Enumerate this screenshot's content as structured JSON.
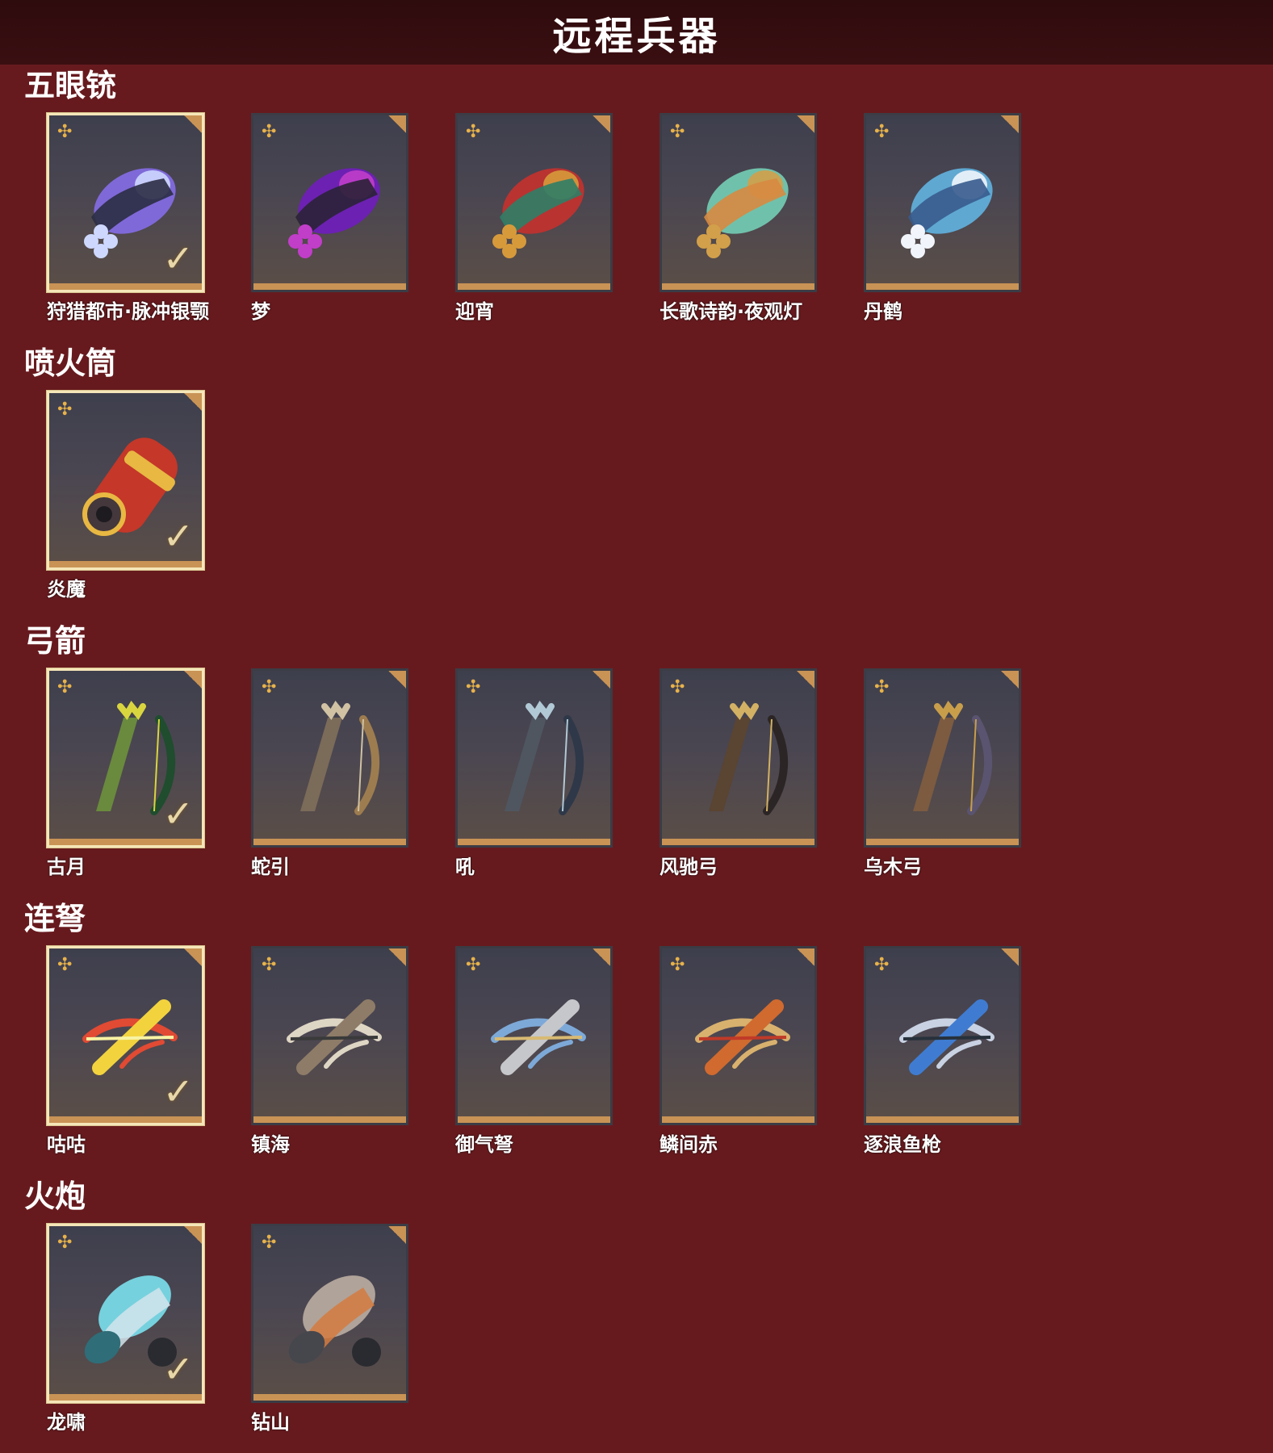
{
  "header": {
    "title": "远程兵器"
  },
  "sections": [
    {
      "title": "五眼铳",
      "items": [
        {
          "label": "狩猎都市·脉冲银颚",
          "equipped": true,
          "icon": "gun-icon",
          "colors": [
            "#7f69d8",
            "#ced8ff",
            "#2b2d44"
          ]
        },
        {
          "label": "梦",
          "equipped": false,
          "icon": "gun-icon",
          "colors": [
            "#6c21b2",
            "#c13ec9",
            "#2b2236"
          ]
        },
        {
          "label": "迎宵",
          "equipped": false,
          "icon": "gun-icon",
          "colors": [
            "#b93331",
            "#d79a3b",
            "#2f7e67"
          ]
        },
        {
          "label": "长歌诗韵·夜观灯",
          "equipped": false,
          "icon": "gun-icon",
          "colors": [
            "#70c1ab",
            "#d2a04a",
            "#d78a40"
          ]
        },
        {
          "label": "丹鹤",
          "equipped": false,
          "icon": "gun-icon",
          "colors": [
            "#5fa8d2",
            "#f1f5fb",
            "#385b8d"
          ]
        }
      ]
    },
    {
      "title": "喷火筒",
      "items": [
        {
          "label": "炎魔",
          "equipped": true,
          "icon": "flamethrower-icon",
          "colors": [
            "#c43729",
            "#e8b842",
            "#44383c"
          ]
        }
      ]
    },
    {
      "title": "弓箭",
      "items": [
        {
          "label": "古月",
          "equipped": true,
          "icon": "bow-icon",
          "colors": [
            "#6a8a3d",
            "#d9d53f",
            "#1f4d2e"
          ]
        },
        {
          "label": "蛇引",
          "equipped": false,
          "icon": "bow-icon",
          "colors": [
            "#7b6b59",
            "#d0c2a3",
            "#9d7c4f"
          ]
        },
        {
          "label": "吼",
          "equipped": false,
          "icon": "bow-icon",
          "colors": [
            "#4f5660",
            "#b1c8d5",
            "#2e3848"
          ]
        },
        {
          "label": "风驰弓",
          "equipped": false,
          "icon": "bow-icon",
          "colors": [
            "#5a4432",
            "#d2b164",
            "#2c2525"
          ]
        },
        {
          "label": "乌木弓",
          "equipped": false,
          "icon": "bow-icon",
          "colors": [
            "#7c5b41",
            "#c89e4b",
            "#5a5470"
          ]
        }
      ]
    },
    {
      "title": "连弩",
      "items": [
        {
          "label": "咕咕",
          "equipped": true,
          "icon": "crossbow-icon",
          "colors": [
            "#f2d33e",
            "#e14a33",
            "#f8f3a3"
          ]
        },
        {
          "label": "镇海",
          "equipped": false,
          "icon": "crossbow-icon",
          "colors": [
            "#8e7c68",
            "#ded6c4",
            "#3a3a3a"
          ]
        },
        {
          "label": "御气弩",
          "equipped": false,
          "icon": "crossbow-icon",
          "colors": [
            "#c6c7ca",
            "#7da9d8",
            "#d8ba72"
          ]
        },
        {
          "label": "鳞间赤",
          "equipped": false,
          "icon": "crossbow-icon",
          "colors": [
            "#d06a2f",
            "#d8b16e",
            "#c03a28"
          ]
        },
        {
          "label": "逐浪鱼枪",
          "equipped": false,
          "icon": "crossbow-icon",
          "colors": [
            "#3f7cd1",
            "#c8d2e2",
            "#27313b"
          ]
        }
      ]
    },
    {
      "title": "火炮",
      "items": [
        {
          "label": "龙啸",
          "equipped": true,
          "icon": "cannon-icon",
          "colors": [
            "#75d1dd",
            "#d3e4ec",
            "#2f6d78"
          ]
        },
        {
          "label": "钻山",
          "equipped": false,
          "icon": "cannon-icon",
          "colors": [
            "#b0a39a",
            "#d57b3f",
            "#45474d"
          ]
        }
      ]
    }
  ]
}
